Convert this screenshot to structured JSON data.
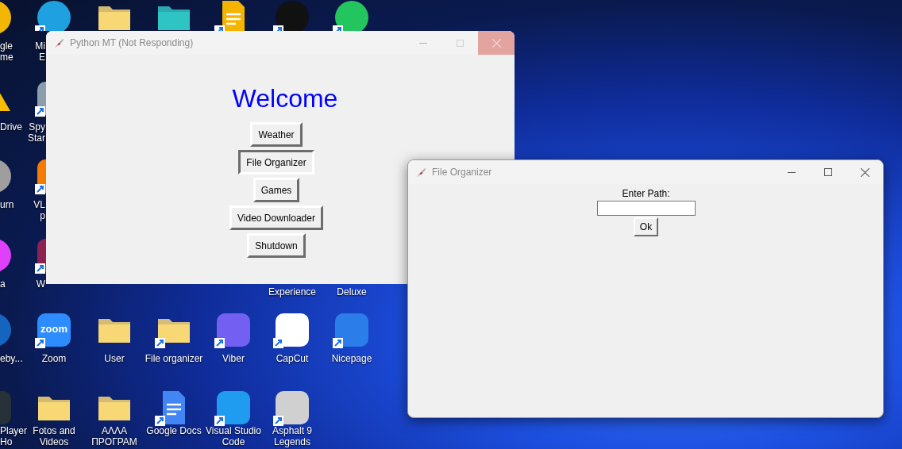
{
  "desktop": {
    "columns": [
      {
        "icons": [
          {
            "kind": "round",
            "color": "#f2b705",
            "label": [
              "gle",
              "me"
            ]
          },
          {
            "kind": "triangle",
            "color": "#fbbc04",
            "label": [
              "Drive"
            ]
          },
          {
            "kind": "round",
            "color": "#9e9e9e",
            "label": [
              "urn"
            ]
          },
          {
            "kind": "round",
            "color": "#e040fb",
            "label": [
              "a"
            ]
          },
          {
            "kind": "round",
            "color": "#1565c0",
            "label": [
              "eby..."
            ]
          },
          {
            "kind": "square",
            "color": "#263238",
            "label": [
              "Player",
              "Ho"
            ]
          }
        ]
      },
      {
        "icons": [
          {
            "kind": "round",
            "color": "#1fa0e0",
            "label": [
              "Mi",
              "E"
            ],
            "shortcut": true
          },
          {
            "kind": "square",
            "color": "#8c9eae",
            "label": [
              "Spy",
              "Star"
            ],
            "shortcut": true
          },
          {
            "kind": "square",
            "color": "#f57c00",
            "label": [
              "VL",
              "p"
            ],
            "shortcut": true
          },
          {
            "kind": "square",
            "color": "#8b2252",
            "label": [
              "W"
            ],
            "shortcut": true
          },
          {
            "kind": "square",
            "color": "#2d8cff",
            "logo_text": "zoom",
            "label": [
              "Zoom"
            ],
            "shortcut": true
          },
          {
            "kind": "folder",
            "color": "#f8d775",
            "label": [
              "Fotos and",
              "Videos"
            ],
            "shortcut": false
          }
        ]
      },
      {
        "icons": [
          {
            "kind": "folder",
            "color": "#f8d775",
            "shortcut": false
          },
          {
            "kind": "folder",
            "color": "#f8d775",
            "label": [
              "User"
            ],
            "shortcut": false
          },
          {
            "kind": "folder",
            "color": "#f8d775",
            "label": [
              "ΑΛΛΑ",
              "ΠΡΟΓΡΑΜ"
            ],
            "shortcut": false
          }
        ]
      },
      {
        "icons": [
          {
            "kind": "folder",
            "color": "#2ec4c4",
            "shortcut": false
          },
          {
            "kind": "folder",
            "color": "#f8d775",
            "label": [
              "File organizer"
            ],
            "shortcut": true
          },
          {
            "kind": "document",
            "color": "#4285f4",
            "label": [
              "Google Docs"
            ],
            "shortcut": true
          }
        ]
      },
      {
        "icons": [
          {
            "kind": "document",
            "color": "#f4b400",
            "shortcut": true
          },
          {
            "kind": "square",
            "color": "#7360f2",
            "label": [
              "Viber"
            ],
            "shortcut": true
          },
          {
            "kind": "square",
            "color": "#1f9cf0",
            "label": [
              "Visual Studio",
              "Code"
            ],
            "shortcut": true
          }
        ]
      },
      {
        "icons": [
          {
            "kind": "round",
            "color": "#111111",
            "shortcut": true
          },
          {
            "kind": "label-only",
            "label": [
              "Experience"
            ]
          },
          {
            "kind": "square",
            "color": "#ffffff",
            "label": [
              "CapCut"
            ],
            "shortcut": true
          },
          {
            "kind": "square",
            "color": "#d0d0d0",
            "label": [
              "Asphalt 9",
              "Legends"
            ],
            "shortcut": true
          }
        ]
      },
      {
        "icons": [
          {
            "kind": "round",
            "color": "#22c55e",
            "shortcut": true
          },
          {
            "kind": "label-only",
            "label": [
              "Deluxe"
            ]
          },
          {
            "kind": "square",
            "color": "#2b7de9",
            "label": [
              "Nicepage"
            ],
            "shortcut": true
          }
        ]
      }
    ]
  },
  "main_window": {
    "title": "Python MT (Not Responding)",
    "heading": "Welcome",
    "buttons": [
      {
        "label": "Weather",
        "pressed": false
      },
      {
        "label": "File Organizer",
        "pressed": true
      },
      {
        "label": "Games",
        "pressed": false
      },
      {
        "label": "Video Downloader",
        "pressed": false
      },
      {
        "label": "Shutdown",
        "pressed": false
      }
    ]
  },
  "organizer_window": {
    "title": "File Organizer",
    "prompt": "Enter Path:",
    "button": "Ok"
  }
}
